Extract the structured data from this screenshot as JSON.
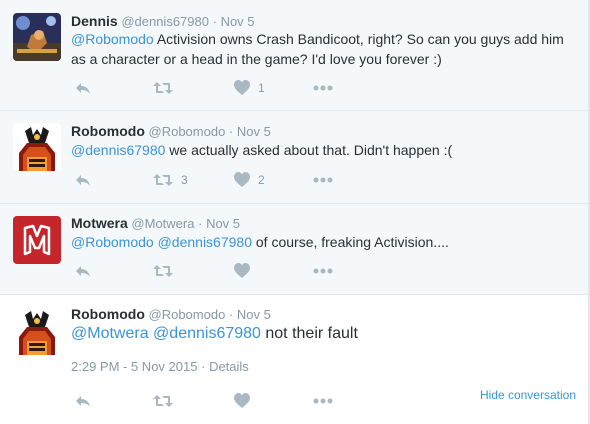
{
  "tweets": [
    {
      "name": "Dennis",
      "handle": "@dennis67980",
      "date": "Nov 5",
      "mention1": "@Robomodo",
      "body": " Activision owns Crash Bandicoot, right? So can you guys add him as a character or a head in the game? I'd love you forever :)",
      "retweets": "",
      "likes": "1"
    },
    {
      "name": "Robomodo",
      "handle": "@Robomodo",
      "date": "Nov 5",
      "mention1": "@dennis67980",
      "body": " we actually asked about that. Didn't happen :(",
      "retweets": "3",
      "likes": "2"
    },
    {
      "name": "Motwera",
      "handle": "@Motwera",
      "date": "Nov 5",
      "mention1": "@Robomodo",
      "mention2": "@dennis67980",
      "body": " of course, freaking Activision....",
      "retweets": "",
      "likes": ""
    },
    {
      "name": "Robomodo",
      "handle": "@Robomodo",
      "date": "Nov 5",
      "mention1": "@Motwera",
      "mention2": "@dennis67980",
      "body": " not their fault",
      "timestamp": "2:29 PM - 5 Nov 2015",
      "details": "Details",
      "hide": "Hide conversation"
    }
  ],
  "separator": "·",
  "icons": {
    "reply": "reply-icon",
    "retweet": "retweet-icon",
    "like": "heart-icon",
    "more": "more-icon"
  },
  "colors": {
    "link": "#3b94d9",
    "muted": "#8899a6",
    "icon": "#aab8c2"
  }
}
